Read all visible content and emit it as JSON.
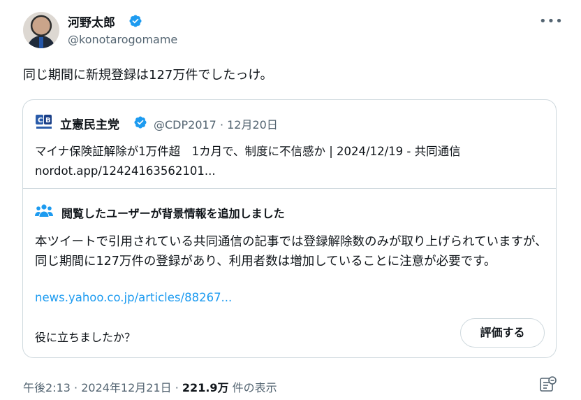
{
  "author": {
    "name": "河野太郎",
    "handle": "@konotarogomame"
  },
  "tweet": {
    "text": "同じ期間に新規登録は127万件でしたっけ。"
  },
  "quoted": {
    "name": "立憲民主党",
    "handle": "@CDP2017",
    "separator": " · ",
    "date": "12月20日",
    "line1": "マイナ保険証解除が1万件超　1カ月で、制度に不信感か | 2024/12/19 - 共同通信",
    "line2": "nordot.app/12424163562101..."
  },
  "community_note": {
    "title": "閲覧したユーザーが背景情報を追加しました",
    "body": "本ツイートで引用されている共同通信の記事では登録解除数のみが取り上げられていますが、同じ期間に127万件の登録があり、利用者数は増加していることに注意が必要です。",
    "link": "news.yahoo.co.jp/articles/88267...",
    "helpful_prompt": "役に立ちましたか？",
    "rate_button": "評価する"
  },
  "footer": {
    "time": "午後2:13",
    "separator": " · ",
    "date": "2024年12月21日",
    "separator2": " · ",
    "views": "221.9万",
    "views_suffix": " 件の表示"
  },
  "icons": {
    "verified": "verified-badge-icon",
    "more": "more-options-icon",
    "party_logo": "cdp-logo-icon",
    "note": "people-icon",
    "analytics": "analytics-icon"
  },
  "colors": {
    "verified_blue": "#1d9bf0",
    "link_blue": "#1d9bf0",
    "secondary_text": "#536471",
    "border": "#cfd9de"
  }
}
